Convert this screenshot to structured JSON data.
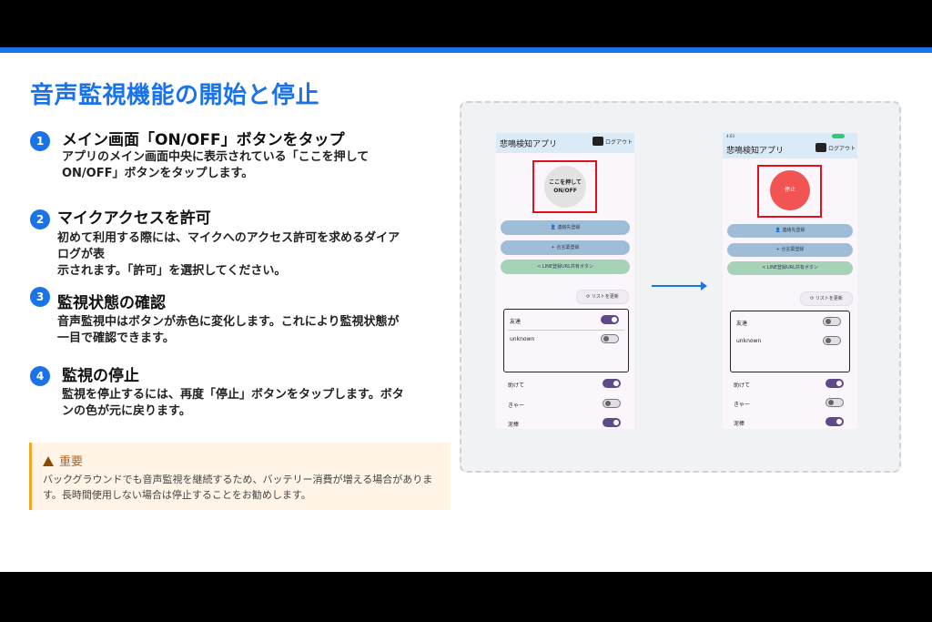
{
  "title": "音声監視機能の開始と停止",
  "steps": [
    {
      "num": "1",
      "title": "メイン画面「ON/OFF」ボタンをタップ",
      "desc": [
        "アプリのメイン画面中央に表示されている「ここを押して",
        "ON/OFF」ボタンをタップします。"
      ]
    },
    {
      "num": "2",
      "title": "マイクアクセスを許可",
      "desc": [
        "初めて利用する際には、マイクへのアクセス許可を求めるダイア",
        "ログが表",
        "示されます。「許可」を選択してください。"
      ]
    },
    {
      "num": "3",
      "title": "監視状態の確認",
      "desc": [
        "音声監視中はボタンが赤色に変化します。これにより監視状態が",
        "一目で確認できます。"
      ]
    },
    {
      "num": "4",
      "title": "監視の停止",
      "desc": [
        "監視を停止するには、再度「停止」ボタンをタップします。ボタ",
        "ンの色が元に戻ります。"
      ]
    }
  ],
  "note": {
    "heading": "重要",
    "body": [
      "バックグラウンドでも音声監視を継続するため、バッテリー消費が増える場合がありま",
      "す。長時間使用しない場合は停止することをお勧めします。"
    ]
  },
  "phone_left": {
    "title": "悲鳴検知アプリ",
    "logout": "ログアウト",
    "main_button": [
      "ここを押して",
      "ON/OFF"
    ],
    "buttons": [
      "連絡先登録",
      "合言葉登録",
      "LINE登録URL共有ボタン"
    ],
    "refresh": "リストを更新",
    "contacts": [
      {
        "name": "友達",
        "on": true
      },
      {
        "name": "unknown",
        "on": false
      }
    ],
    "keywords": [
      {
        "name": "助けて",
        "on": true
      },
      {
        "name": "きゃー",
        "on": false
      },
      {
        "name": "泥棒",
        "on": true
      }
    ]
  },
  "phone_right": {
    "status_time": "4:03",
    "title": "悲鳴検知アプリ",
    "logout": "ログアウト",
    "main_button": [
      "停止"
    ],
    "buttons": [
      "連絡先登録",
      "合言葉登録",
      "LINE登録URL共有ボタン"
    ],
    "refresh": "リストを更新",
    "contacts": [
      {
        "name": "友達",
        "on": false
      },
      {
        "name": "unknown",
        "on": false
      }
    ],
    "keywords": [
      {
        "name": "助けて",
        "on": true
      },
      {
        "name": "きゃー",
        "on": false
      },
      {
        "name": "泥棒",
        "on": true
      }
    ]
  },
  "colors": {
    "accent": "#1a73e8",
    "stop": "#f25454",
    "highlight": "#e0101c"
  }
}
